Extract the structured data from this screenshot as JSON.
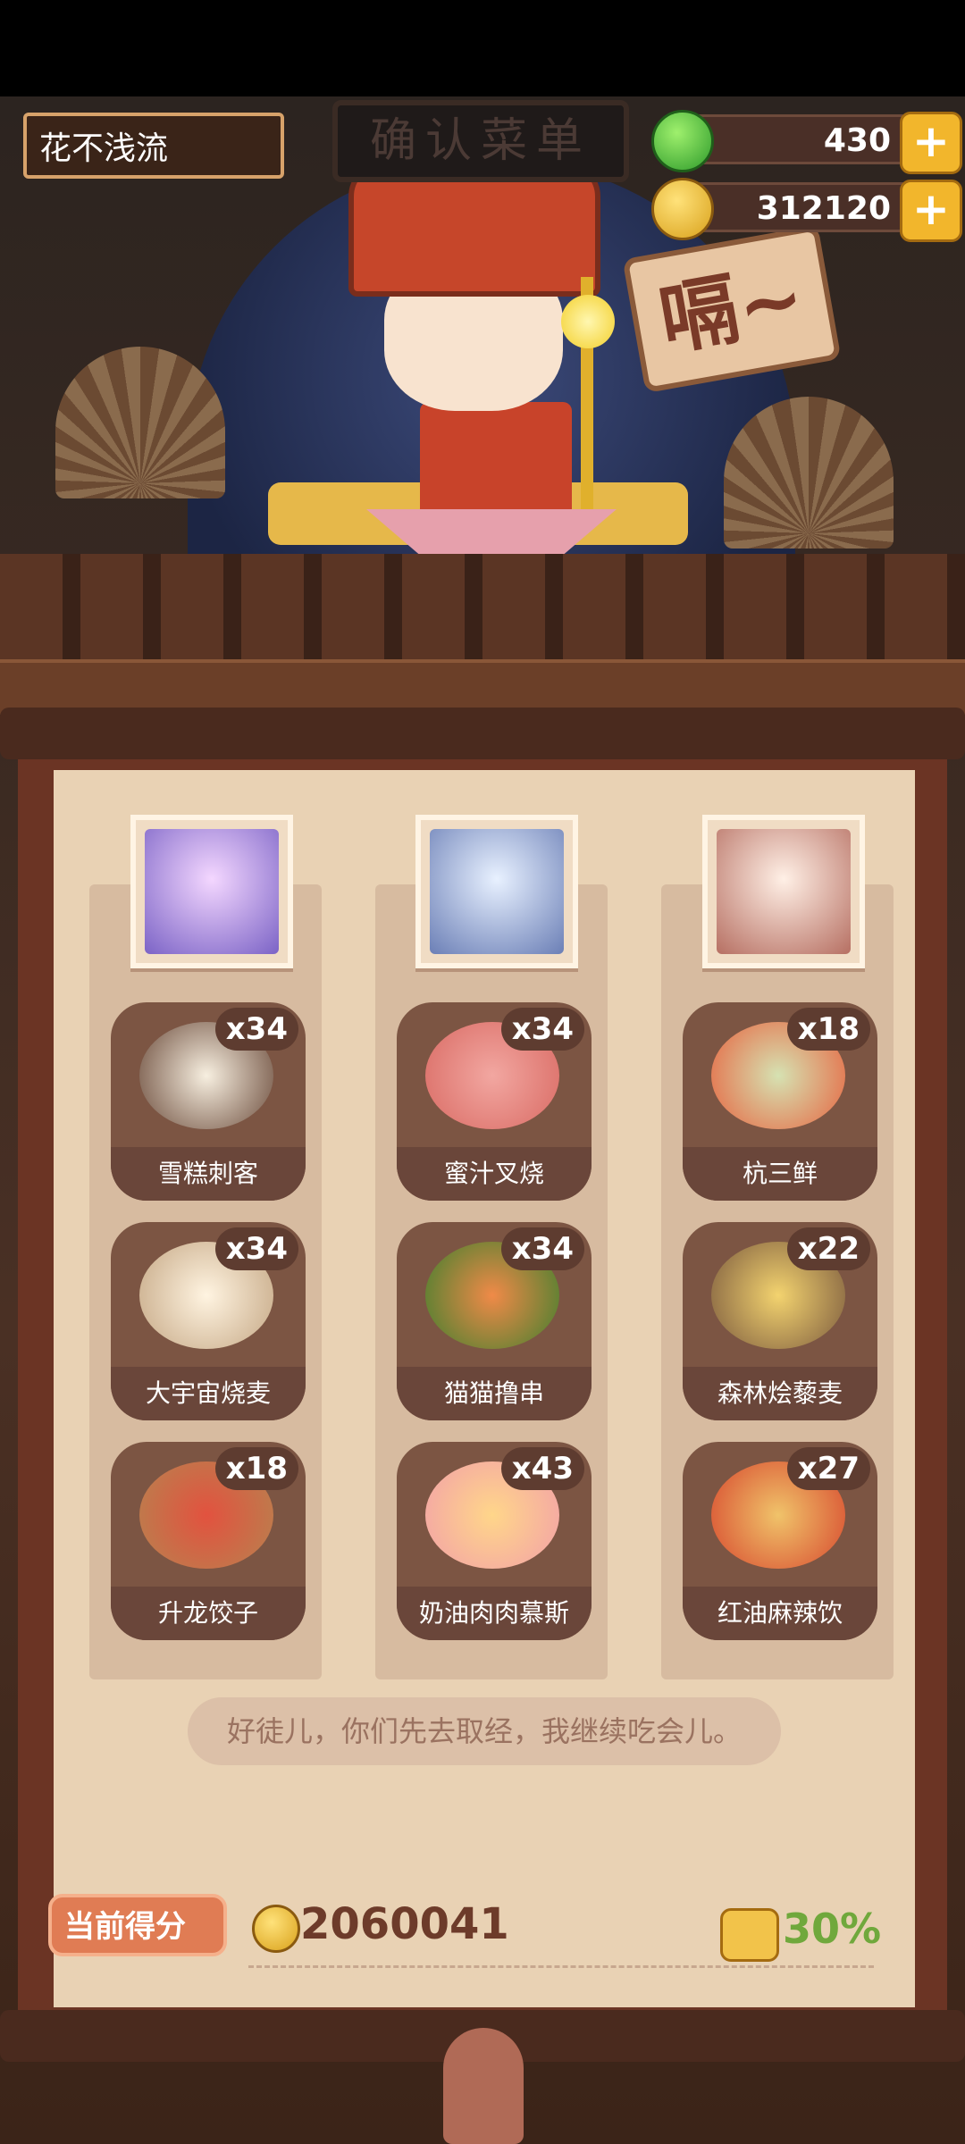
{
  "player": {
    "name": "花不浅流"
  },
  "sign": {
    "label": "确认菜单"
  },
  "currencies": {
    "jade": {
      "value": "430",
      "icon": "jade-icon"
    },
    "coins": {
      "value": "312120",
      "icon": "coin-icon"
    },
    "plus_label": "+"
  },
  "speech_bubble": {
    "text": "嗝~"
  },
  "columns": [
    {
      "character": {
        "icon": "character-portrait-purple-mage"
      },
      "dishes": [
        {
          "name": "雪糕刺客",
          "count": "x34"
        },
        {
          "name": "大宇宙烧麦",
          "count": "x34"
        },
        {
          "name": "升龙饺子",
          "count": "x18"
        }
      ]
    },
    {
      "character": {
        "icon": "character-portrait-silver-hair"
      },
      "dishes": [
        {
          "name": "蜜汁叉烧",
          "count": "x34"
        },
        {
          "name": "猫猫撸串",
          "count": "x34"
        },
        {
          "name": "奶油肉肉慕斯",
          "count": "x43"
        }
      ]
    },
    {
      "character": {
        "icon": "character-portrait-detective"
      },
      "dishes": [
        {
          "name": "杭三鲜",
          "count": "x18"
        },
        {
          "name": "森林烩藜麦",
          "count": "x22"
        },
        {
          "name": "红油麻辣饮",
          "count": "x27"
        }
      ]
    }
  ],
  "quote": {
    "text": "好徒儿，你们先去取经，我继续吃会儿。"
  },
  "score": {
    "label": "当前得分",
    "value": "2060041",
    "bonus_percent": "30%"
  }
}
